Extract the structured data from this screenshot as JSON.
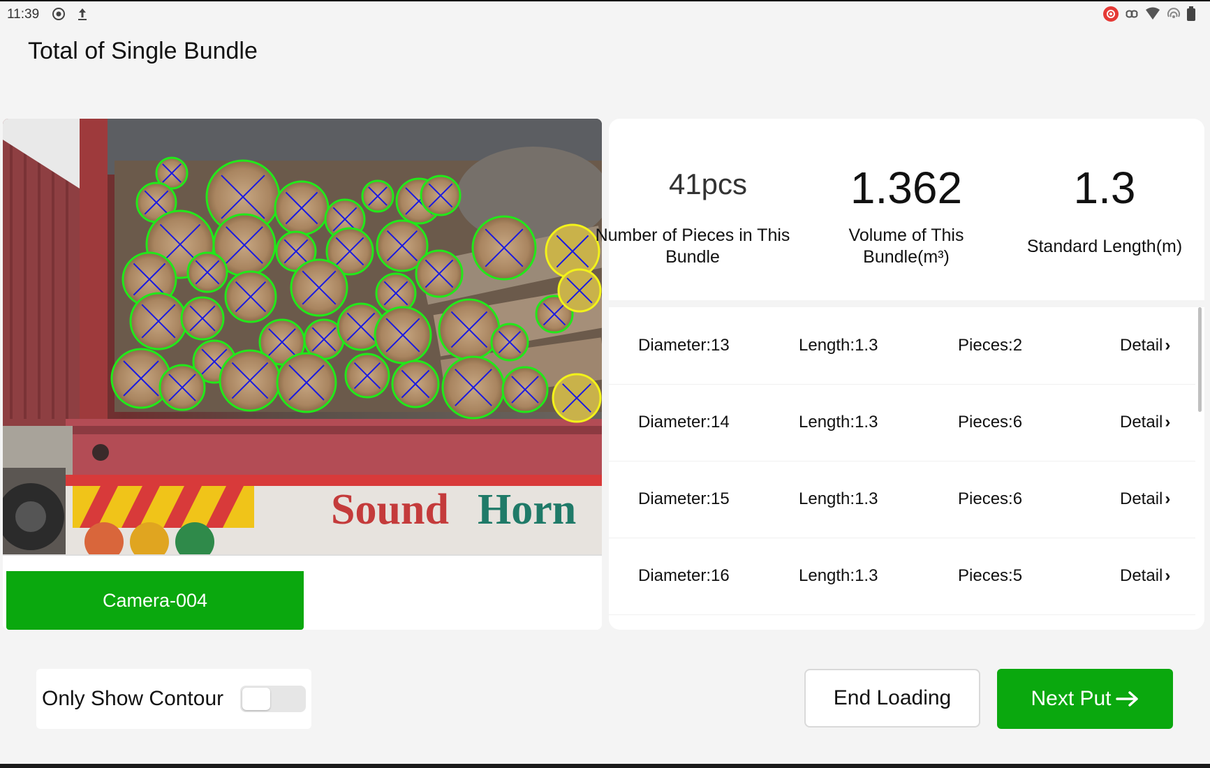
{
  "status_bar": {
    "time": "11:39",
    "left_icons": [
      "record-icon",
      "upload-icon"
    ],
    "right_icons": [
      "screen-record-icon",
      "vpn-icon",
      "wifi-icon",
      "hotspot-icon",
      "battery-icon"
    ]
  },
  "page": {
    "title": "Total of Single Bundle"
  },
  "camera": {
    "tab_label": "Camera-004",
    "image_text": {
      "sign_left": "Sound",
      "sign_right": "Horn"
    },
    "colors": {
      "contour_normal": "#22e81a",
      "contour_highlight": "#f2f21a",
      "cross_lines": "#1a1ae0",
      "tab_active": "#0aa80e"
    }
  },
  "stats": {
    "pieces": {
      "value": "41pcs",
      "label": "Number of Pieces in This Bundle"
    },
    "volume": {
      "value": "1.362",
      "label": "Volume of This Bundle(m³)"
    },
    "length": {
      "value": "1.3",
      "label": "Standard Length(m)"
    }
  },
  "details": [
    {
      "diameter": "Diameter:13",
      "length": "Length:1.3",
      "pieces": "Pieces:2",
      "action": "Detail"
    },
    {
      "diameter": "Diameter:14",
      "length": "Length:1.3",
      "pieces": "Pieces:6",
      "action": "Detail"
    },
    {
      "diameter": "Diameter:15",
      "length": "Length:1.3",
      "pieces": "Pieces:6",
      "action": "Detail"
    },
    {
      "diameter": "Diameter:16",
      "length": "Length:1.3",
      "pieces": "Pieces:5",
      "action": "Detail"
    }
  ],
  "controls": {
    "contour_label": "Only Show Contour",
    "contour_toggle_on": false,
    "end_button": "End Loading",
    "next_button": "Next Put",
    "accent_color": "#0aa80e"
  }
}
